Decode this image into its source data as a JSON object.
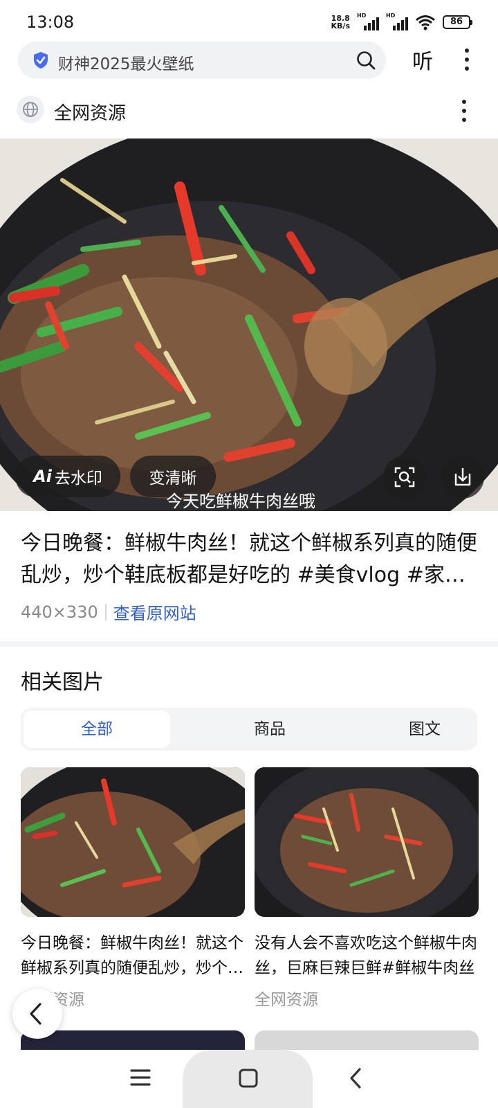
{
  "status_bar": {
    "time": "13:08",
    "net_speed_value": "18.8",
    "net_speed_unit": "KB/s",
    "sim1_label": "HD",
    "sim2_label": "HD",
    "battery": "86"
  },
  "search": {
    "query": "财神2025最火壁纸",
    "listen_label": "听"
  },
  "source": {
    "label": "全网资源"
  },
  "image": {
    "watermark_button": "去水印",
    "ai_mark": "Ai",
    "enhance_button": "变清晰",
    "caption": "今天吃鲜椒牛肉丝哦"
  },
  "result": {
    "title": "今日晚餐：鲜椒牛肉丝！就这个鲜椒系列真的随便乱炒，炒个鞋底板都是好吃的 #美食vlog #家常菜",
    "size": "440×330",
    "source_link": "查看原网站"
  },
  "related": {
    "heading": "相关图片",
    "tabs": [
      {
        "label": "全部",
        "active": true
      },
      {
        "label": "商品",
        "active": false
      },
      {
        "label": "图文",
        "active": false
      }
    ],
    "cards": [
      {
        "title": "今日晚餐：鲜椒牛肉丝！就这个鲜椒系列真的随便乱炒，炒个鞋底板都是好吃的",
        "source": "全网资源"
      },
      {
        "title": "没有人会不喜欢吃这个鲜椒牛肉丝，巨麻巨辣巨鲜#鲜椒牛肉丝",
        "source": "全网资源"
      }
    ]
  },
  "colors": {
    "accent": "#2f5fd0",
    "search_bg": "#f1f2f4"
  }
}
